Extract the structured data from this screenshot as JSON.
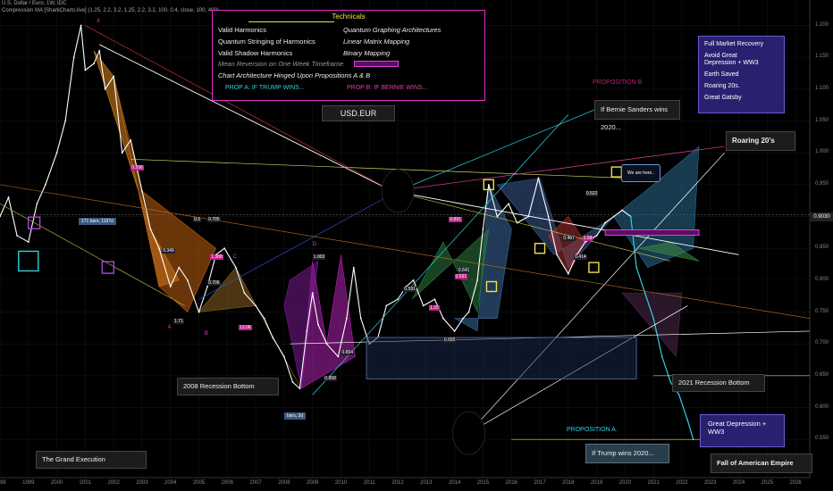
{
  "header": {
    "title": "U.S. Dollar / Euro, 1W, IDC",
    "indicator": "Compression MA [SharkCharts.live] (1.25, 2.2, 3.2, 1.25, 2.2, 3.2, 100, 0.4, close, 100, 400)"
  },
  "current_price": "0.9030",
  "technicals": {
    "title": "Technicals",
    "left_items": [
      "Valid Harmonics",
      "Quantum Stringing of Harmonics",
      "Valid Shadow Harmonics"
    ],
    "right_items": [
      "Quantum Graphing Architectures",
      "Linear Matrix Mapping",
      "Binary Mapping"
    ],
    "mean_reversion": "Mean Reversion on One Week Timeframe",
    "architecture": "Chart Architecture Hinged Upon Propositions A & B",
    "prop_a": "PROP A:    IF TRUMP WINS...",
    "prop_b": "PROP B:    IF BERNIE WINS..."
  },
  "annotations": {
    "symbol_box": "USD.EUR",
    "recession_2008": "2008 Recession Bottom",
    "recession_2021": "2021 Recession Bottom",
    "grand_execution": "The Grand Execution",
    "bernie": "If Bernie Sanders wins 2020...",
    "trump": "If Trump wins 2020...",
    "roaring": "Roaring 20's",
    "fall": "Fall of American Empire",
    "proposition_a": "PROPOSITION A.",
    "proposition_b": "PROPOSITION B.",
    "we_are_here": "We are here..",
    "bars_label": "171 bars, 1197d",
    "bars_label_2": "bars, 2d",
    "recovery_box": [
      "Full Market Recovery",
      "Avoid Great",
      "Depression + WW3",
      "Earth Saved",
      "Roaring 20s.",
      "Great Gatsby"
    ],
    "depression_box": "Great Depression + WW3"
  },
  "fib_labels": [
    "0.206",
    "0.349",
    "0.705",
    "1.388",
    "0.706",
    "1.003",
    "0.591",
    "0.591",
    "0.692",
    "0.891",
    "0.522",
    "0.467",
    "1.58",
    "0.414",
    "1.71",
    "13.06",
    "0.858",
    "0.894",
    "1.25",
    "0.641",
    "0.5"
  ],
  "point_labels": [
    "X",
    "A",
    "B",
    "C",
    "D"
  ],
  "colors": {
    "background": "#000000",
    "price_line": "#ffffff",
    "magenta": "#e030d0",
    "orange_pattern": "#e08a20",
    "blue_pattern": "#3a6aa0",
    "cyan": "#30d0e0",
    "yellow": "#f0e040",
    "purple_box": "#2a2070"
  },
  "chart_data": {
    "type": "line",
    "title": "U.S. Dollar / Euro, 1W, IDC",
    "ylim": [
      0.49,
      1.24
    ],
    "y_ticks": [
      0.55,
      0.6,
      0.65,
      0.7,
      0.75,
      0.8,
      0.85,
      0.9,
      0.95,
      1.0,
      1.05,
      1.1,
      1.15,
      1.2
    ],
    "x_ticks": [
      "1998",
      "1999",
      "2000",
      "2001",
      "2002",
      "2003",
      "2004",
      "2005",
      "2006",
      "2007",
      "2008",
      "2009",
      "2010",
      "2011",
      "2012",
      "2013",
      "2014",
      "2015",
      "2016",
      "2017",
      "2018",
      "2019",
      "2020",
      "2021",
      "2022",
      "2023",
      "2024",
      "2025",
      "2026"
    ],
    "xlim": [
      1998.0,
      2026.5
    ],
    "series": [
      {
        "x": [
          1998.0,
          1998.3,
          1998.6,
          1999.0,
          1999.3,
          1999.6,
          2000.0,
          2000.3,
          2000.6,
          2000.85,
          2001.0,
          2001.3,
          2001.5,
          2001.7,
          2002.0,
          2002.3,
          2002.6,
          2003.0,
          2003.3,
          2003.6,
          2004.0,
          2004.3,
          2004.6,
          2005.0,
          2005.3,
          2005.6,
          2005.9,
          2006.3,
          2006.6,
          2007.0,
          2007.3,
          2007.6,
          2008.0,
          2008.3,
          2008.55,
          2008.8,
          2009.0,
          2009.2,
          2009.5,
          2009.9,
          2010.2,
          2010.45,
          2010.7,
          2011.0,
          2011.3,
          2011.6,
          2012.0,
          2012.3,
          2012.55,
          2012.9,
          2013.3,
          2013.6,
          2014.0,
          2014.3,
          2014.5,
          2014.8,
          2015.0,
          2015.2,
          2015.5,
          2015.9,
          2016.2,
          2016.6,
          2016.95,
          2017.3,
          2017.6,
          2018.0,
          2018.3,
          2018.6,
          2019.0,
          2019.3,
          2019.6,
          2019.9,
          2020.2
        ],
        "values": [
          0.9,
          0.93,
          0.87,
          0.86,
          0.92,
          0.95,
          1.0,
          1.05,
          1.15,
          1.2,
          1.13,
          1.14,
          1.16,
          1.1,
          1.12,
          1.0,
          1.02,
          0.94,
          0.88,
          0.85,
          0.79,
          0.82,
          0.8,
          0.75,
          0.79,
          0.84,
          0.85,
          0.82,
          0.78,
          0.76,
          0.74,
          0.71,
          0.68,
          0.64,
          0.63,
          0.72,
          0.78,
          0.73,
          0.7,
          0.68,
          0.74,
          0.82,
          0.74,
          0.7,
          0.71,
          0.76,
          0.77,
          0.79,
          0.8,
          0.76,
          0.77,
          0.74,
          0.72,
          0.74,
          0.75,
          0.8,
          0.88,
          0.95,
          0.9,
          0.92,
          0.89,
          0.9,
          0.96,
          0.9,
          0.84,
          0.81,
          0.84,
          0.86,
          0.87,
          0.89,
          0.9,
          0.91,
          0.9
        ]
      },
      {
        "name": "projection",
        "x": [
          2020.2,
          2020.4,
          2020.7,
          2021.0,
          2021.3,
          2021.6,
          2021.9,
          2022.2,
          2022.4
        ],
        "values": [
          0.9,
          0.82,
          0.78,
          0.74,
          0.68,
          0.64,
          0.62,
          0.58,
          0.55
        ]
      }
    ]
  }
}
